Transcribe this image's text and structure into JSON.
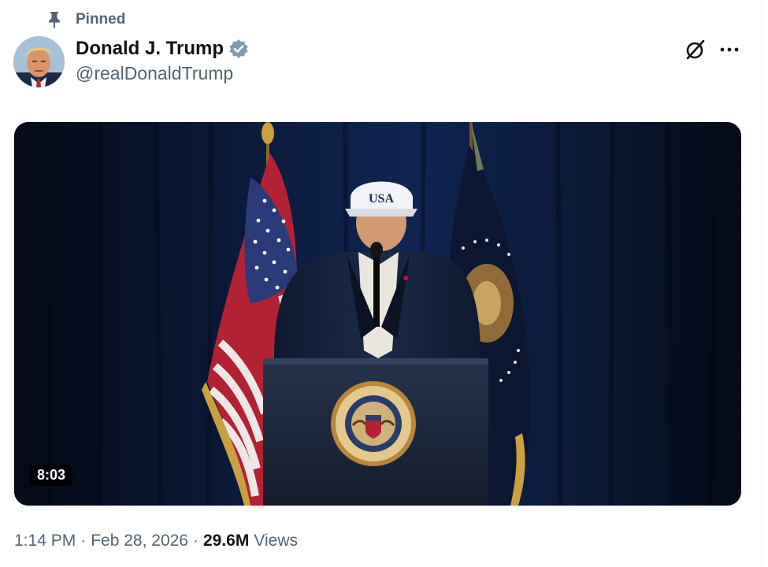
{
  "pinned": {
    "label": "Pinned",
    "icon": "pin-icon"
  },
  "author": {
    "display_name": "Donald J. Trump",
    "handle": "@realDonaldTrump",
    "verified_icon": "verified-badge-icon",
    "verified_color": "#829aab",
    "avatar_icon": "avatar-image"
  },
  "actions": {
    "grok_icon": "grok-icon",
    "more_icon": "more-options-icon"
  },
  "media": {
    "type": "video",
    "duration": "8:03",
    "cap_text": "USA"
  },
  "meta": {
    "time": "1:14 PM",
    "separator": "·",
    "date": "Feb 28, 2026",
    "views_count": "29.6M",
    "views_label": "Views"
  },
  "colors": {
    "secondary_text": "#536471",
    "primary_text": "#0f1419",
    "curtain": "#0b1a3a",
    "flag_red": "#b22234",
    "flag_blue": "#3c3b6e",
    "seal_gold": "#c9a043"
  }
}
